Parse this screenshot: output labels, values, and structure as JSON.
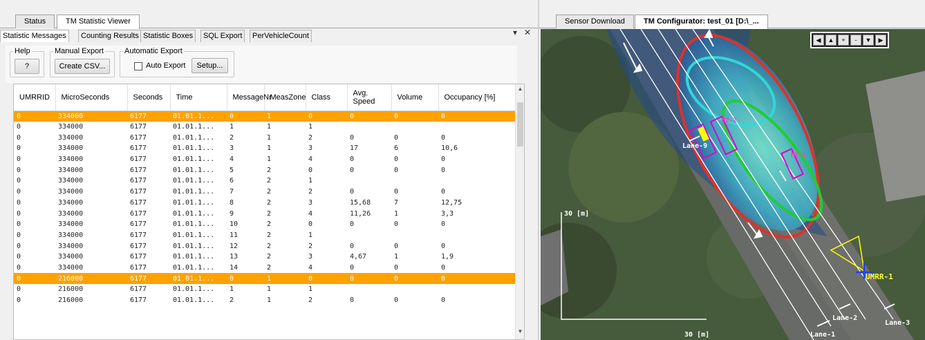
{
  "left_pane": {
    "tabs": [
      "Status",
      "TM Statistic Viewer"
    ],
    "controls": {
      "pin": "▾",
      "close": "✕"
    },
    "sub_tabs": [
      "Statistic Messages",
      "Counting Results",
      "Statistic Boxes",
      "SQL Export",
      "PerVehicleCount"
    ],
    "help": {
      "title": "Help",
      "button": "?"
    },
    "manual_export": {
      "title": "Manual Export",
      "button": "Create CSV..."
    },
    "auto_export": {
      "title": "Automatic Export",
      "checkbox_label": "Auto Export",
      "setup": "Setup..."
    },
    "columns": [
      "UMRRID",
      "MicroSeconds",
      "Seconds",
      "Time",
      "MessageNr",
      "MeasZone",
      "Class",
      "Avg. Speed",
      "Volume",
      "Occupancy [%]"
    ],
    "rows": [
      {
        "sel": true,
        "c": [
          "0",
          "334000",
          "6177",
          "01.01.1...",
          "0",
          "1",
          "0",
          "0",
          "0",
          "0"
        ]
      },
      {
        "sel": false,
        "c": [
          "0",
          "334000",
          "6177",
          "01.01.1...",
          "1",
          "1",
          "1",
          "",
          "",
          ""
        ]
      },
      {
        "sel": false,
        "c": [
          "0",
          "334000",
          "6177",
          "01.01.1...",
          "2",
          "1",
          "2",
          "0",
          "0",
          "0"
        ]
      },
      {
        "sel": false,
        "c": [
          "0",
          "334000",
          "6177",
          "01.01.1...",
          "3",
          "1",
          "3",
          "17",
          "6",
          "10,6"
        ]
      },
      {
        "sel": false,
        "c": [
          "0",
          "334000",
          "6177",
          "01.01.1...",
          "4",
          "1",
          "4",
          "0",
          "0",
          "0"
        ]
      },
      {
        "sel": false,
        "c": [
          "0",
          "334000",
          "6177",
          "01.01.1...",
          "5",
          "2",
          "0",
          "0",
          "0",
          "0"
        ]
      },
      {
        "sel": false,
        "c": [
          "0",
          "334000",
          "6177",
          "01.01.1...",
          "6",
          "2",
          "1",
          "",
          "",
          ""
        ]
      },
      {
        "sel": false,
        "c": [
          "0",
          "334000",
          "6177",
          "01.01.1...",
          "7",
          "2",
          "2",
          "0",
          "0",
          "0"
        ]
      },
      {
        "sel": false,
        "c": [
          "0",
          "334000",
          "6177",
          "01.01.1...",
          "8",
          "2",
          "3",
          "15,68",
          "7",
          "12,75"
        ]
      },
      {
        "sel": false,
        "c": [
          "0",
          "334000",
          "6177",
          "01.01.1...",
          "9",
          "2",
          "4",
          "11,26",
          "1",
          "3,3"
        ]
      },
      {
        "sel": false,
        "c": [
          "0",
          "334000",
          "6177",
          "01.01.1...",
          "10",
          "2",
          "0",
          "0",
          "0",
          "0"
        ]
      },
      {
        "sel": false,
        "c": [
          "0",
          "334000",
          "6177",
          "01.01.1...",
          "11",
          "2",
          "1",
          "",
          "",
          ""
        ]
      },
      {
        "sel": false,
        "c": [
          "0",
          "334000",
          "6177",
          "01.01.1...",
          "12",
          "2",
          "2",
          "0",
          "0",
          "0"
        ]
      },
      {
        "sel": false,
        "c": [
          "0",
          "334000",
          "6177",
          "01.01.1...",
          "13",
          "2",
          "3",
          "4,67",
          "1",
          "1,9"
        ]
      },
      {
        "sel": false,
        "c": [
          "0",
          "334000",
          "6177",
          "01.01.1...",
          "14",
          "2",
          "4",
          "0",
          "0",
          "0"
        ]
      },
      {
        "sel": true,
        "c": [
          "0",
          "216000",
          "6177",
          "01.01.1...",
          "0",
          "1",
          "0",
          "0",
          "0",
          "0"
        ]
      },
      {
        "sel": false,
        "c": [
          "0",
          "216000",
          "6177",
          "01.01.1...",
          "1",
          "1",
          "1",
          "",
          "",
          ""
        ]
      },
      {
        "sel": false,
        "c": [
          "0",
          "216000",
          "6177",
          "01.01.1...",
          "2",
          "1",
          "2",
          "0",
          "0",
          "0"
        ]
      }
    ],
    "colors": {
      "selected_row": "#ffa200",
      "alt_text": "#b08000"
    }
  },
  "right_pane": {
    "tabs": [
      "Sensor Download",
      "TM Configurator: test_01 [D:\\_..."
    ],
    "nav_buttons": [
      "◀",
      "▲",
      "+",
      "-",
      "▼",
      "▶"
    ],
    "scale_y": "30 [m]",
    "scale_x": "30 [m]",
    "lanes": [
      "Lane-9",
      "Lane-1",
      "Lane-2",
      "Lane-3"
    ],
    "sensor_label": "UMRR-1",
    "zone_labels": [
      "MZ-2",
      "MZ-1"
    ]
  }
}
